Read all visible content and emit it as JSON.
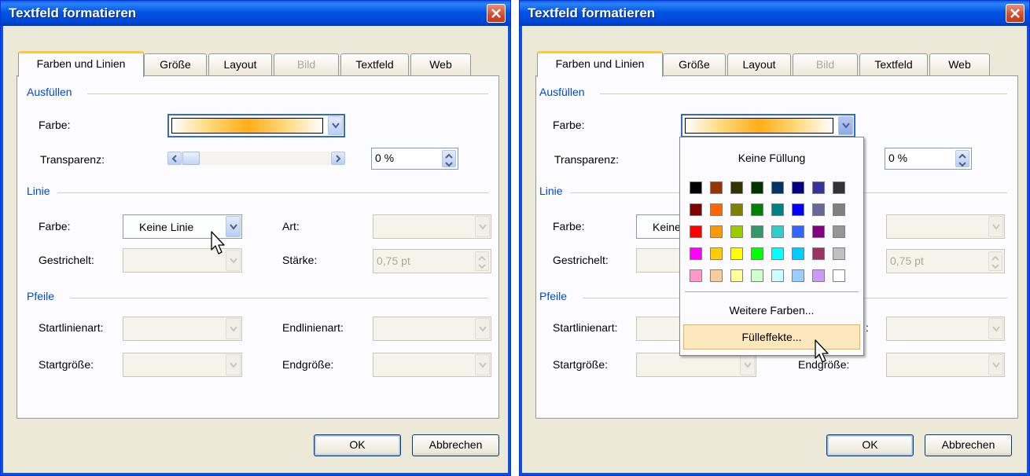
{
  "dialog1": {
    "title": "Textfeld formatieren",
    "tabs": [
      "Farben und Linien",
      "Größe",
      "Layout",
      "Bild",
      "Textfeld",
      "Web"
    ],
    "fill_section": "Ausfüllen",
    "fill_color_label": "Farbe:",
    "transparency_label": "Transparenz:",
    "transparency_value": "0 %",
    "line_section": "Linie",
    "line_color_label": "Farbe:",
    "line_color_value": "Keine Linie",
    "dashed_label": "Gestrichelt:",
    "style_label": "Art:",
    "weight_label": "Stärke:",
    "weight_value": "0,75 pt",
    "arrows_section": "Pfeile",
    "start_style_label": "Startlinienart:",
    "end_style_label": "Endlinienart:",
    "start_size_label": "Startgröße:",
    "end_size_label": "Endgröße:",
    "ok_label": "OK",
    "cancel_label": "Abbrechen"
  },
  "dialog2": {
    "title": "Textfeld formatieren",
    "tabs": [
      "Farben und Linien",
      "Größe",
      "Layout",
      "Bild",
      "Textfeld",
      "Web"
    ],
    "fill_section": "Ausfüllen",
    "fill_color_label": "Farbe:",
    "transparency_label": "Transparenz:",
    "transparency_value": "0 %",
    "line_section": "Linie",
    "line_color_label": "Farbe:",
    "line_color_value": "Keine",
    "dashed_label": "Gestrichelt:",
    "weight_label": "Stärke:",
    "weight_value": "0,75 pt",
    "arrows_section": "Pfeile",
    "start_style_label": "Startlinienart:",
    "end_style_label_visible": ":",
    "start_size_label": "Startgröße:",
    "end_size_label": "Endgröße:",
    "ok_label": "OK",
    "cancel_label": "Abbrechen"
  },
  "color_popup": {
    "no_fill_label": "Keine Füllung",
    "more_colors_label": "Weitere Farben...",
    "fill_effects_label": "Fülleffekte...",
    "palette": [
      [
        "#000000",
        "#993300",
        "#333300",
        "#003300",
        "#003366",
        "#000080",
        "#333399",
        "#333333"
      ],
      [
        "#800000",
        "#ff6600",
        "#808000",
        "#008000",
        "#008080",
        "#0000ff",
        "#666699",
        "#808080"
      ],
      [
        "#ff0000",
        "#ff9900",
        "#99cc00",
        "#339966",
        "#33cccc",
        "#3366ff",
        "#800080",
        "#969696"
      ],
      [
        "#ff00ff",
        "#ffcc00",
        "#ffff00",
        "#00ff00",
        "#00ffff",
        "#00ccff",
        "#993366",
        "#c0c0c0"
      ],
      [
        "#ff99cc",
        "#ffcc99",
        "#ffff99",
        "#ccffcc",
        "#ccffff",
        "#99ccff",
        "#cc99ff",
        "#ffffff"
      ]
    ]
  },
  "icons": {
    "close": "close-icon",
    "dropdown": "chevron-down-icon",
    "spinner": "spin-up-down-icon",
    "cursor": "mouse-pointer-icon"
  }
}
